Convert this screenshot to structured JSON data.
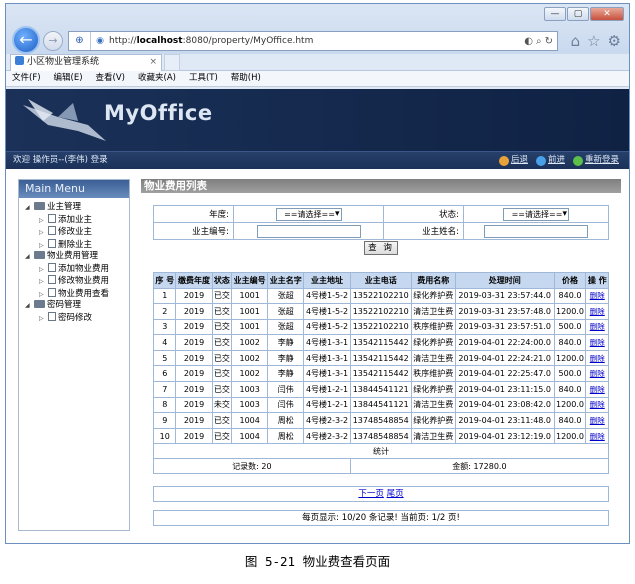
{
  "browser": {
    "window_controls": [
      "—",
      "▢",
      "✕"
    ],
    "back_glyph": "←",
    "forward_glyph": "→",
    "address_prefix": "http://",
    "address_host": "localhost",
    "address_path": ":8080/property/MyOffice.htm",
    "tab_title": "小区物业管理系统",
    "tab_close": "×",
    "menu": [
      "文件(F)",
      "编辑(E)",
      "查看(V)",
      "收藏夹(A)",
      "工具(T)",
      "帮助(H)"
    ]
  },
  "app": {
    "logo": "MyOffice",
    "welcome": "欢迎 操作员--(李伟) 登录",
    "nav": {
      "back": "后退",
      "forward": "前进",
      "relogin": "重新登录"
    }
  },
  "sidebar": {
    "title": "Main Menu",
    "groups": [
      {
        "label": "业主管理",
        "items": [
          "添加业主",
          "修改业主",
          "删除业主"
        ]
      },
      {
        "label": "物业费用管理",
        "items": [
          "添加物业费用",
          "修改物业费用",
          "物业费用查看"
        ]
      },
      {
        "label": "密码管理",
        "items": [
          "密码修改"
        ]
      }
    ]
  },
  "panel": {
    "title": "物业费用列表",
    "filter": {
      "year_label": "年度:",
      "year_value": "==请选择==",
      "status_label": "状态:",
      "status_value": "==请选择==",
      "owner_id_label": "业主编号:",
      "owner_name_label": "业主姓名:",
      "query_button": "查 询"
    },
    "table": {
      "headers": [
        "序 号",
        "缴费年度",
        "状态",
        "业主编号",
        "业主名字",
        "业主地址",
        "业主电话",
        "费用名称",
        "处理时间",
        "价格",
        "操 作"
      ],
      "rows": [
        [
          "1",
          "2019",
          "已交",
          "1001",
          "张超",
          "4号楼1-5-2",
          "13522102210",
          "绿化养护费",
          "2019-03-31 23:57:44.0",
          "840.0",
          "删除"
        ],
        [
          "2",
          "2019",
          "已交",
          "1001",
          "张超",
          "4号楼1-5-2",
          "13522102210",
          "清洁卫生费",
          "2019-03-31 23:57:48.0",
          "1200.0",
          "删除"
        ],
        [
          "3",
          "2019",
          "已交",
          "1001",
          "张超",
          "4号楼1-5-2",
          "13522102210",
          "秩序维护费",
          "2019-03-31 23:57:51.0",
          "500.0",
          "删除"
        ],
        [
          "4",
          "2019",
          "已交",
          "1002",
          "李静",
          "4号楼1-3-1",
          "13542115442",
          "绿化养护费",
          "2019-04-01 22:24:00.0",
          "840.0",
          "删除"
        ],
        [
          "5",
          "2019",
          "已交",
          "1002",
          "李静",
          "4号楼1-3-1",
          "13542115442",
          "清洁卫生费",
          "2019-04-01 22:24:21.0",
          "1200.0",
          "删除"
        ],
        [
          "6",
          "2019",
          "已交",
          "1002",
          "李静",
          "4号楼1-3-1",
          "13542115442",
          "秩序维护费",
          "2019-04-01 22:25:47.0",
          "500.0",
          "删除"
        ],
        [
          "7",
          "2019",
          "已交",
          "1003",
          "闫伟",
          "4号楼1-2-1",
          "13844541121",
          "绿化养护费",
          "2019-04-01 23:11:15.0",
          "840.0",
          "删除"
        ],
        [
          "8",
          "2019",
          "未交",
          "1003",
          "闫伟",
          "4号楼1-2-1",
          "13844541121",
          "清洁卫生费",
          "2019-04-01 23:08:42.0",
          "1200.0",
          "删除"
        ],
        [
          "9",
          "2019",
          "已交",
          "1004",
          "周松",
          "4号楼2-3-2",
          "13748548854",
          "绿化养护费",
          "2019-04-01 23:11:48.0",
          "840.0",
          "删除"
        ],
        [
          "10",
          "2019",
          "已交",
          "1004",
          "周松",
          "4号楼2-3-2",
          "13748548854",
          "清洁卫生费",
          "2019-04-01 23:12:19.0",
          "1200.0",
          "删除"
        ]
      ],
      "stats_label": "统计",
      "record_count": "记录数: 20",
      "amount": "金额: 17280.0"
    },
    "pager": {
      "next": "下一页",
      "last": "尾页"
    },
    "page_info": "每页显示: 10/20 条记录! 当前页: 1/2 页!"
  },
  "caption": "图 5-21 物业费查看页面",
  "colors": {
    "banner": "#1b3158",
    "table_header": "#c6d8ef",
    "border": "#9fb8d8",
    "link": "#0000cc"
  }
}
